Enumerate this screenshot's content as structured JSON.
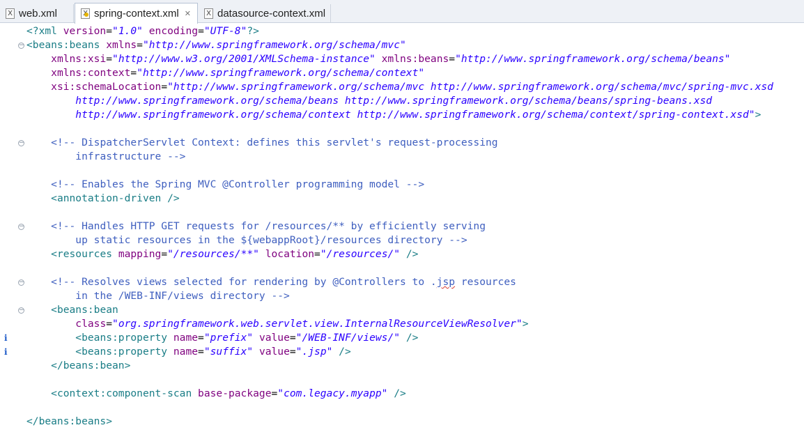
{
  "tabs": [
    {
      "label": "web.xml",
      "active": false,
      "modified": false
    },
    {
      "label": "spring-context.xml",
      "active": true,
      "modified": true
    },
    {
      "label": "datasource-context.xml",
      "active": false,
      "modified": false
    }
  ],
  "icons": {
    "xml_file": "xml-file-icon",
    "close": "close-icon",
    "fold": "fold-collapse-icon",
    "info": "info-marker-icon"
  },
  "colors": {
    "tag": "#1a7d86",
    "attribute": "#7f007f",
    "value": "#2a00ff",
    "comment": "#3f5fbf"
  },
  "code": {
    "l1_open": "<?xml ",
    "l1_a1": "version",
    "l1_eq1": "=",
    "l1_v1": "\"1.0\"",
    "l1_sp": " ",
    "l1_a2": "encoding",
    "l1_eq2": "=",
    "l1_v2": "\"UTF-8\"",
    "l1_close": "?>",
    "l2_tag": "<beans:beans",
    "l2_sp": " ",
    "l2_a": "xmlns",
    "l2_eq": "=",
    "l2_v": "\"http://www.springframework.org/schema/mvc\"",
    "l3_ind": "    ",
    "l3_a1": "xmlns:xsi",
    "l3_eq1": "=",
    "l3_v1": "\"http://www.w3.org/2001/XMLSchema-instance\"",
    "l3_sp": " ",
    "l3_a2": "xmlns:beans",
    "l3_eq2": "=",
    "l3_v2": "\"http://www.springframework.org/schema/beans\"",
    "l4_ind": "    ",
    "l4_a": "xmlns:context",
    "l4_eq": "=",
    "l4_v": "\"http://www.springframework.org/schema/context\"",
    "l5_ind": "    ",
    "l5_a": "xsi:schemaLocation",
    "l5_eq": "=",
    "l5_v": "\"http://www.springframework.org/schema/mvc http://www.springframework.org/schema/mvc/spring-mvc.xsd",
    "l6_ind": "        ",
    "l6_v": "http://www.springframework.org/schema/beans http://www.springframework.org/schema/beans/spring-beans.xsd",
    "l7_ind": "        ",
    "l7_v": "http://www.springframework.org/schema/context http://www.springframework.org/schema/context/spring-context.xsd\"",
    "l7_close": ">",
    "l9_ind": "    ",
    "l9_cm": "<!-- DispatcherServlet Context: defines this servlet's request-processing",
    "l10_ind": "        ",
    "l10_cm": "infrastructure -->",
    "l12_ind": "    ",
    "l12_cm": "<!-- Enables the Spring MVC @Controller programming model -->",
    "l13_ind": "    ",
    "l13_tag": "<annotation-driven />",
    "l15_ind": "    ",
    "l15_cm": "<!-- Handles HTTP GET requests for /resources/** by efficiently serving",
    "l16_ind": "        ",
    "l16_cm": "up static resources in the ${webappRoot}/resources directory -->",
    "l17_ind": "    ",
    "l17_tag": "<resources",
    "l17_sp1": " ",
    "l17_a1": "mapping",
    "l17_eq1": "=",
    "l17_v1": "\"/resources/**\"",
    "l17_sp2": " ",
    "l17_a2": "location",
    "l17_eq2": "=",
    "l17_v2": "\"/resources/\"",
    "l17_close": " />",
    "l19_ind": "    ",
    "l19_cm_a": "<!-- Resolves views selected for rendering by @Controllers to .",
    "l19_cm_sp": "jsp",
    "l19_cm_b": " resources",
    "l20_ind": "        ",
    "l20_cm": "in the /WEB-INF/views directory -->",
    "l21_ind": "    ",
    "l21_tag": "<beans:bean",
    "l22_ind": "        ",
    "l22_a": "class",
    "l22_eq": "=",
    "l22_v": "\"org.springframework.web.servlet.view.InternalResourceViewResolver\"",
    "l22_close": ">",
    "l23_ind": "        ",
    "l23_tag": "<beans:property",
    "l23_sp1": " ",
    "l23_a1": "name",
    "l23_eq1": "=",
    "l23_v1": "\"prefix\"",
    "l23_sp2": " ",
    "l23_a2": "value",
    "l23_eq2": "=",
    "l23_v2": "\"/WEB-INF/views/\"",
    "l23_close": " />",
    "l24_ind": "        ",
    "l24_tag": "<beans:property",
    "l24_sp1": " ",
    "l24_a1": "name",
    "l24_eq1": "=",
    "l24_v1": "\"suffix\"",
    "l24_sp2": " ",
    "l24_a2": "value",
    "l24_eq2": "=",
    "l24_v2": "\".jsp\"",
    "l24_close": " />",
    "l25_ind": "    ",
    "l25_tag": "</beans:bean>",
    "l27_ind": "    ",
    "l27_tag": "<context:component-scan",
    "l27_sp": " ",
    "l27_a": "base-package",
    "l27_eq": "=",
    "l27_v": "\"com.legacy.myapp\"",
    "l27_close": " />",
    "l29_tag": "</beans:beans>"
  }
}
